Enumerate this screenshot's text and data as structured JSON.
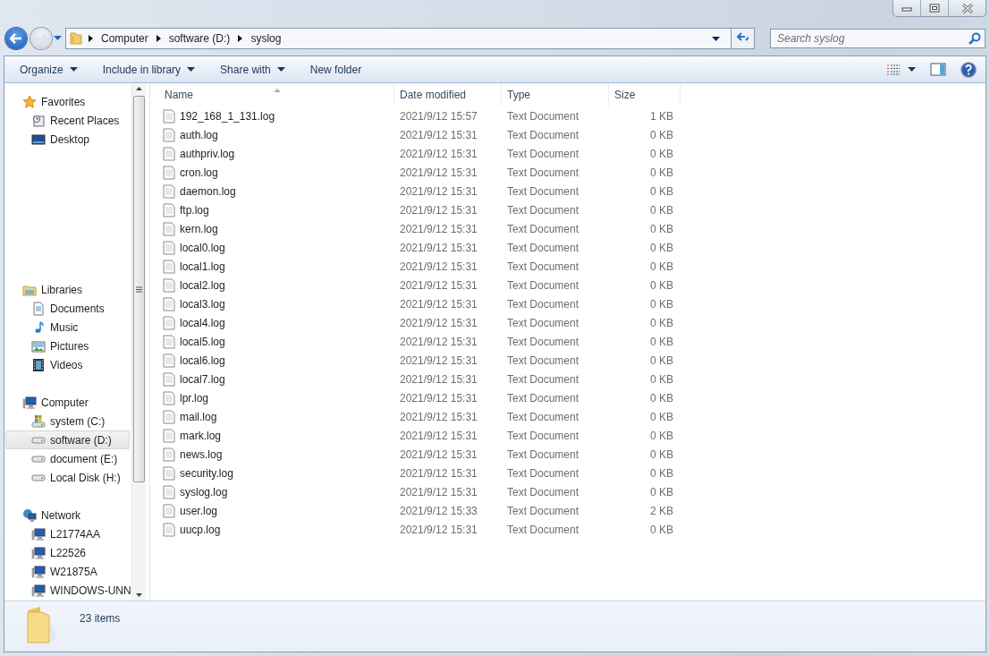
{
  "address_bar": {
    "breadcrumbs": [
      "Computer",
      "software (D:)",
      "syslog"
    ]
  },
  "search": {
    "placeholder": "Search syslog"
  },
  "toolbar": {
    "buttons": [
      {
        "label": "Organize",
        "dropdown": true
      },
      {
        "label": "Include in library",
        "dropdown": true
      },
      {
        "label": "Share with",
        "dropdown": true
      },
      {
        "label": "New folder",
        "dropdown": false
      }
    ]
  },
  "sidebar": {
    "groups": [
      {
        "label": "Favorites",
        "kind": "favorites",
        "items": [
          {
            "label": "Recent Places",
            "kind": "recent",
            "selected": false
          },
          {
            "label": "Desktop",
            "kind": "desktop",
            "selected": false
          }
        ]
      },
      {
        "label": "Libraries",
        "kind": "libraries",
        "items": [
          {
            "label": "Documents",
            "kind": "documents",
            "selected": false
          },
          {
            "label": "Music",
            "kind": "music",
            "selected": false
          },
          {
            "label": "Pictures",
            "kind": "pictures",
            "selected": false
          },
          {
            "label": "Videos",
            "kind": "videos",
            "selected": false
          }
        ]
      },
      {
        "label": "Computer",
        "kind": "computer",
        "items": [
          {
            "label": "system (C:)",
            "kind": "system-drive",
            "selected": false
          },
          {
            "label": "software (D:)",
            "kind": "drive",
            "selected": true
          },
          {
            "label": "document (E:)",
            "kind": "drive",
            "selected": false
          },
          {
            "label": "Local Disk (H:)",
            "kind": "drive",
            "selected": false
          }
        ]
      },
      {
        "label": "Network",
        "kind": "network",
        "items": [
          {
            "label": "L21774AA",
            "kind": "computer",
            "selected": false
          },
          {
            "label": "L22526",
            "kind": "computer",
            "selected": false
          },
          {
            "label": "W21875A",
            "kind": "computer",
            "selected": false
          },
          {
            "label": "WINDOWS-UNN",
            "kind": "computer",
            "selected": false
          }
        ]
      }
    ]
  },
  "file_list": {
    "columns": [
      "Name",
      "Date modified",
      "Type",
      "Size"
    ],
    "rows": [
      {
        "name": "192_168_1_131.log",
        "date_modified": "2021/9/12 15:57",
        "type": "Text Document",
        "size": "1 KB"
      },
      {
        "name": "auth.log",
        "date_modified": "2021/9/12 15:31",
        "type": "Text Document",
        "size": "0 KB"
      },
      {
        "name": "authpriv.log",
        "date_modified": "2021/9/12 15:31",
        "type": "Text Document",
        "size": "0 KB"
      },
      {
        "name": "cron.log",
        "date_modified": "2021/9/12 15:31",
        "type": "Text Document",
        "size": "0 KB"
      },
      {
        "name": "daemon.log",
        "date_modified": "2021/9/12 15:31",
        "type": "Text Document",
        "size": "0 KB"
      },
      {
        "name": "ftp.log",
        "date_modified": "2021/9/12 15:31",
        "type": "Text Document",
        "size": "0 KB"
      },
      {
        "name": "kern.log",
        "date_modified": "2021/9/12 15:31",
        "type": "Text Document",
        "size": "0 KB"
      },
      {
        "name": "local0.log",
        "date_modified": "2021/9/12 15:31",
        "type": "Text Document",
        "size": "0 KB"
      },
      {
        "name": "local1.log",
        "date_modified": "2021/9/12 15:31",
        "type": "Text Document",
        "size": "0 KB"
      },
      {
        "name": "local2.log",
        "date_modified": "2021/9/12 15:31",
        "type": "Text Document",
        "size": "0 KB"
      },
      {
        "name": "local3.log",
        "date_modified": "2021/9/12 15:31",
        "type": "Text Document",
        "size": "0 KB"
      },
      {
        "name": "local4.log",
        "date_modified": "2021/9/12 15:31",
        "type": "Text Document",
        "size": "0 KB"
      },
      {
        "name": "local5.log",
        "date_modified": "2021/9/12 15:31",
        "type": "Text Document",
        "size": "0 KB"
      },
      {
        "name": "local6.log",
        "date_modified": "2021/9/12 15:31",
        "type": "Text Document",
        "size": "0 KB"
      },
      {
        "name": "local7.log",
        "date_modified": "2021/9/12 15:31",
        "type": "Text Document",
        "size": "0 KB"
      },
      {
        "name": "lpr.log",
        "date_modified": "2021/9/12 15:31",
        "type": "Text Document",
        "size": "0 KB"
      },
      {
        "name": "mail.log",
        "date_modified": "2021/9/12 15:31",
        "type": "Text Document",
        "size": "0 KB"
      },
      {
        "name": "mark.log",
        "date_modified": "2021/9/12 15:31",
        "type": "Text Document",
        "size": "0 KB"
      },
      {
        "name": "news.log",
        "date_modified": "2021/9/12 15:31",
        "type": "Text Document",
        "size": "0 KB"
      },
      {
        "name": "security.log",
        "date_modified": "2021/9/12 15:31",
        "type": "Text Document",
        "size": "0 KB"
      },
      {
        "name": "syslog.log",
        "date_modified": "2021/9/12 15:31",
        "type": "Text Document",
        "size": "0 KB"
      },
      {
        "name": "user.log",
        "date_modified": "2021/9/12 15:33",
        "type": "Text Document",
        "size": "2 KB"
      },
      {
        "name": "uucp.log",
        "date_modified": "2021/9/12 15:31",
        "type": "Text Document",
        "size": "0 KB"
      }
    ]
  },
  "status_bar": {
    "item_count": "23 items"
  }
}
